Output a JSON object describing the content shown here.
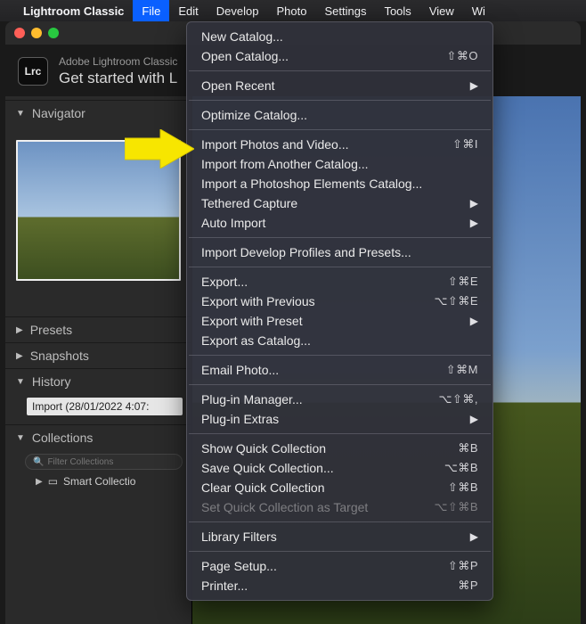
{
  "menubar": {
    "app": "Lightroom Classic",
    "items": [
      "File",
      "Edit",
      "Develop",
      "Photo",
      "Settings",
      "Tools",
      "View",
      "Wi"
    ]
  },
  "header": {
    "badge": "Lrc",
    "small": "Adobe Lightroom Classic",
    "big": "Get started with L"
  },
  "sidebar": {
    "navigator": "Navigator",
    "presets": "Presets",
    "snapshots": "Snapshots",
    "history": "History",
    "history_item": "Import (28/01/2022 4:07:",
    "collections": "Collections",
    "filter_placeholder": "Filter Collections",
    "smart": "Smart Collectio"
  },
  "menu": {
    "new_catalog": "New Catalog...",
    "open_catalog": "Open Catalog...",
    "open_catalog_sc": "⇧⌘O",
    "open_recent": "Open Recent",
    "optimize": "Optimize Catalog...",
    "import_pv": "Import Photos and Video...",
    "import_pv_sc": "⇧⌘I",
    "import_another": "Import from Another Catalog...",
    "import_pse": "Import a Photoshop Elements Catalog...",
    "tethered": "Tethered Capture",
    "auto_import": "Auto Import",
    "import_dev": "Import Develop Profiles and Presets...",
    "export": "Export...",
    "export_sc": "⇧⌘E",
    "export_prev": "Export with Previous",
    "export_prev_sc": "⌥⇧⌘E",
    "export_preset": "Export with Preset",
    "export_cat": "Export as Catalog...",
    "email": "Email Photo...",
    "email_sc": "⇧⌘M",
    "plugin_mgr": "Plug-in Manager...",
    "plugin_mgr_sc": "⌥⇧⌘,",
    "plugin_ex": "Plug-in Extras",
    "show_qc": "Show Quick Collection",
    "show_qc_sc": "⌘B",
    "save_qc": "Save Quick Collection...",
    "save_qc_sc": "⌥⌘B",
    "clear_qc": "Clear Quick Collection",
    "clear_qc_sc": "⇧⌘B",
    "set_qc": "Set Quick Collection as Target",
    "set_qc_sc": "⌥⇧⌘B",
    "lib_filters": "Library Filters",
    "page_setup": "Page Setup...",
    "page_setup_sc": "⇧⌘P",
    "printer": "Printer...",
    "printer_sc": "⌘P"
  }
}
